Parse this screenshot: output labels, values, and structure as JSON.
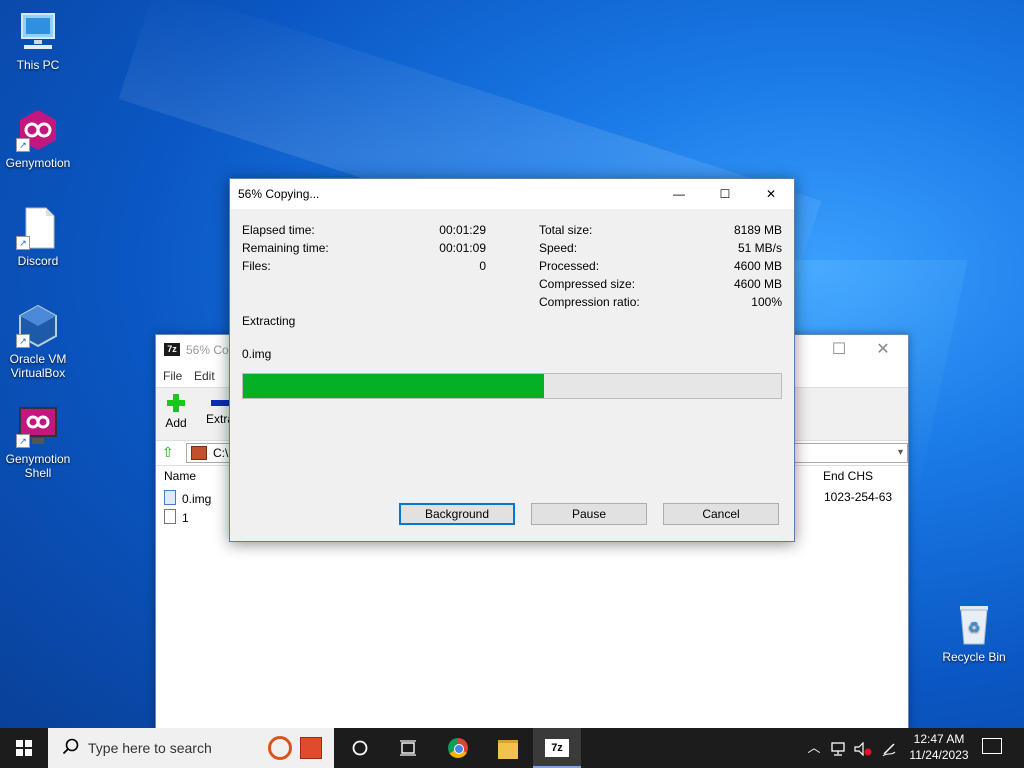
{
  "desktop": {
    "icons": [
      {
        "label": "This PC"
      },
      {
        "label": "Genymotion"
      },
      {
        "label": "Discord"
      },
      {
        "label": "Oracle VM VirtualBox"
      },
      {
        "label": "Genymotion Shell"
      },
      {
        "label": "Recycle Bin"
      }
    ]
  },
  "bg_window": {
    "logo": "7z",
    "title": "56% Copy",
    "menu": [
      "File",
      "Edit"
    ],
    "toolbar": {
      "add": "Add",
      "extract": "Extra"
    },
    "path": "C:\\",
    "columns": {
      "name": "Name",
      "end_chs": "End CHS"
    },
    "rows": [
      {
        "name": "0.img",
        "end_chs": "1023-254-63"
      },
      {
        "name": "1",
        "end_chs": ""
      }
    ]
  },
  "dialog": {
    "title": "56% Copying...",
    "left": [
      {
        "label": "Elapsed time:",
        "value": "00:01:29"
      },
      {
        "label": "Remaining time:",
        "value": "00:01:09"
      },
      {
        "label": "Files:",
        "value": "0"
      }
    ],
    "right": [
      {
        "label": "Total size:",
        "value": "8189 MB"
      },
      {
        "label": "Speed:",
        "value": "51 MB/s"
      },
      {
        "label": "Processed:",
        "value": "4600 MB"
      },
      {
        "label": "Compressed size:",
        "value": "4600 MB"
      },
      {
        "label": "Compression ratio:",
        "value": "100%"
      }
    ],
    "status": "Extracting",
    "current_file": "0.img",
    "progress_percent": 56,
    "buttons": {
      "background": "Background",
      "pause": "Pause",
      "cancel": "Cancel"
    },
    "progress_color": "#06b025"
  },
  "taskbar": {
    "search_placeholder": "Type here to search",
    "sevenzip_label": "7z",
    "time": "12:47 AM",
    "date": "11/24/2023"
  }
}
